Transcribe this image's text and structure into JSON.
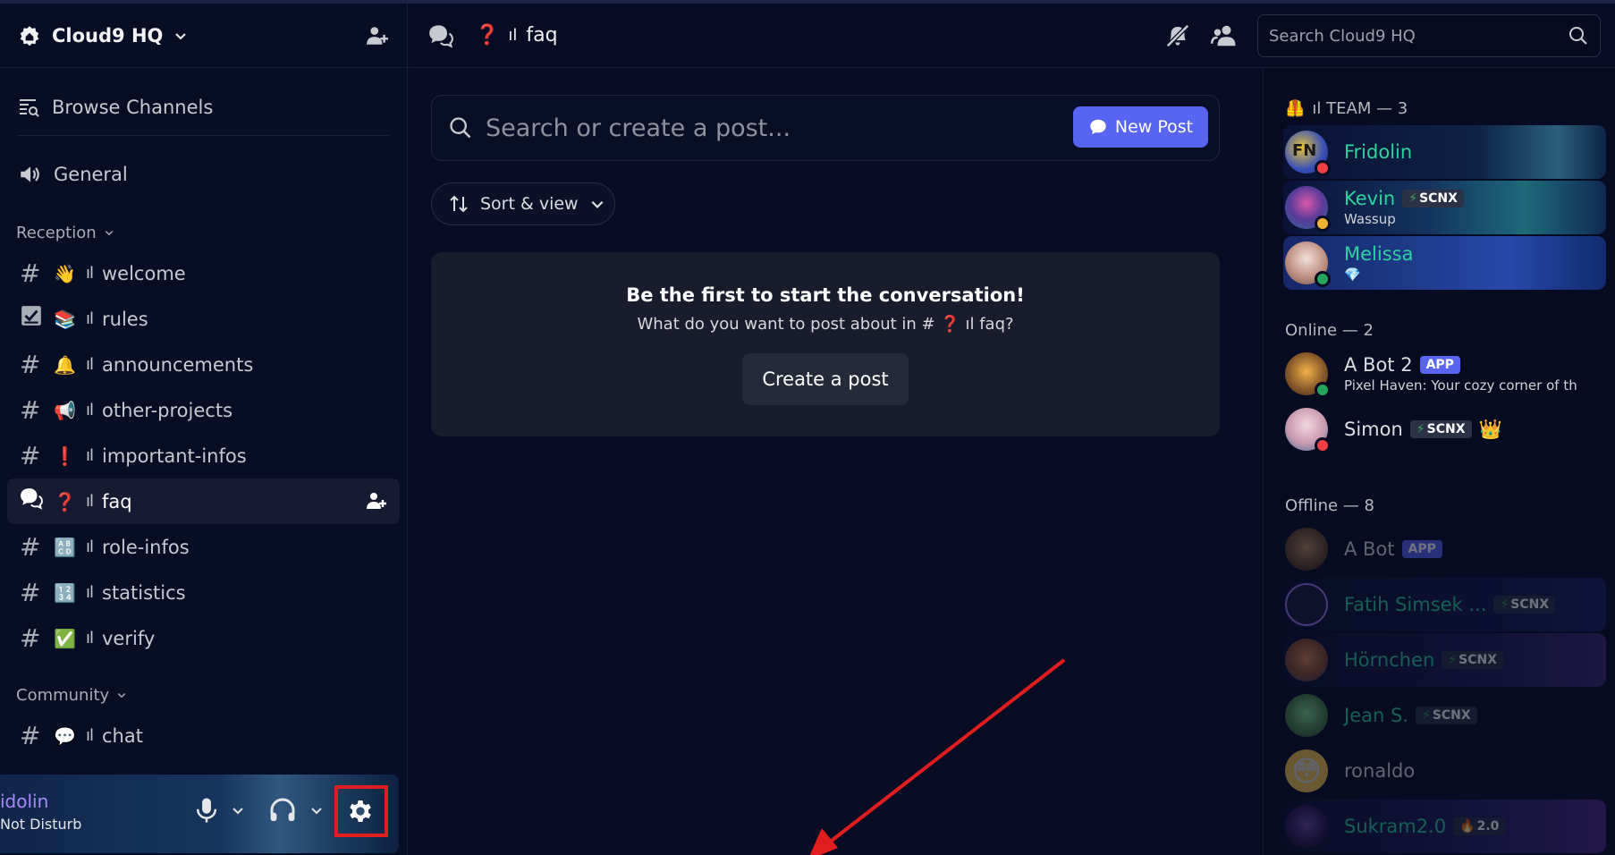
{
  "server": {
    "name": "Cloud9 HQ"
  },
  "sidebar": {
    "browse_label": "Browse Channels",
    "general_label": "General",
    "categories": [
      {
        "name": "Reception",
        "channels": [
          {
            "type": "text",
            "emoji": "👋",
            "sep": "ıl",
            "name": "welcome"
          },
          {
            "type": "rules",
            "emoji": "📚",
            "sep": "ıl",
            "name": "rules"
          },
          {
            "type": "text",
            "emoji": "🔔",
            "sep": "ıl",
            "name": "announcements"
          },
          {
            "type": "text",
            "emoji": "📢",
            "sep": "ıl",
            "name": "other-projects"
          },
          {
            "type": "text",
            "emoji": "❗",
            "sep": "ıl",
            "name": "important-infos"
          },
          {
            "type": "forum",
            "emoji": "❓",
            "sep": "ıl",
            "name": "faq",
            "active": true
          },
          {
            "type": "text",
            "emoji": "🔠",
            "sep": "ıl",
            "name": "role-infos"
          },
          {
            "type": "text",
            "emoji": "🔢",
            "sep": "ıl",
            "name": "statistics"
          },
          {
            "type": "text",
            "emoji": "✅",
            "sep": "ıl",
            "name": "verify"
          }
        ]
      },
      {
        "name": "Community",
        "channels": [
          {
            "type": "text",
            "emoji": "💬",
            "sep": "ıl",
            "name": "chat"
          }
        ]
      }
    ]
  },
  "user_panel": {
    "name": "idolin",
    "status": "Not Disturb"
  },
  "topbar": {
    "channel_emoji": "❓",
    "channel_sep": "ıl",
    "channel_name": "faq",
    "search_placeholder": "Search Cloud9 HQ"
  },
  "forum": {
    "search_placeholder": "Search or create a post...",
    "new_post_label": "New Post",
    "sort_label": "Sort & view",
    "empty_title": "Be the first to start the conversation!",
    "empty_subtitle": "What do you want to post about in # ❓ ıl faq?",
    "create_post_label": "Create a post"
  },
  "members": {
    "groups": [
      {
        "label": "ıl TEAM — 3",
        "emoji": "🦺",
        "items": [
          {
            "name": "Fridolin",
            "color": "#2dd4a0",
            "status": "dnd",
            "banner": "banner1"
          },
          {
            "name": "Kevin",
            "color": "#2dd4a0",
            "tag": "SCNX",
            "sub": "Wassup",
            "status": "idle",
            "banner": "banner2"
          },
          {
            "name": "Melissa",
            "color": "#2dd4a0",
            "sub_emoji": "💎",
            "status": "online",
            "banner": "banner3"
          }
        ]
      },
      {
        "label": "Online — 2",
        "items": [
          {
            "name": "A Bot 2",
            "color": "#dbdee1",
            "app_tag": "APP",
            "sub": "Pixel Haven: Your cozy corner of th",
            "status": "online"
          },
          {
            "name": "Simon",
            "color": "#dbdee1",
            "tag": "SCNX",
            "crown": "👑",
            "status": "dnd"
          }
        ]
      },
      {
        "label": "Offline — 8",
        "items": [
          {
            "name": "A Bot",
            "color": "#dbdee1",
            "app_tag": "APP"
          },
          {
            "name": "Fatih Simsek ...",
            "color": "#2dd4a0",
            "tag": "SCNX",
            "banner": "banner4"
          },
          {
            "name": "Hörnchen",
            "color": "#2dd4a0",
            "tag": "SCNX",
            "banner": "banner5"
          },
          {
            "name": "Jean S.",
            "color": "#2dd4a0",
            "tag": "SCNX"
          },
          {
            "name": "ronaldo",
            "color": "#dbdee1",
            "avatar_emoji": "😳"
          },
          {
            "name": "Sukram2.0",
            "color": "#2dd4a0",
            "tag": "2.0",
            "tag_emoji": "🔥",
            "banner": "banner6"
          }
        ]
      }
    ]
  },
  "colors": {
    "accent": "#5865f2",
    "background": "#070c24",
    "role_teal": "#2dd4a0",
    "dnd": "#f23f43",
    "online": "#23a55a",
    "idle": "#f0b232",
    "annotation_red": "#e11d1d"
  }
}
